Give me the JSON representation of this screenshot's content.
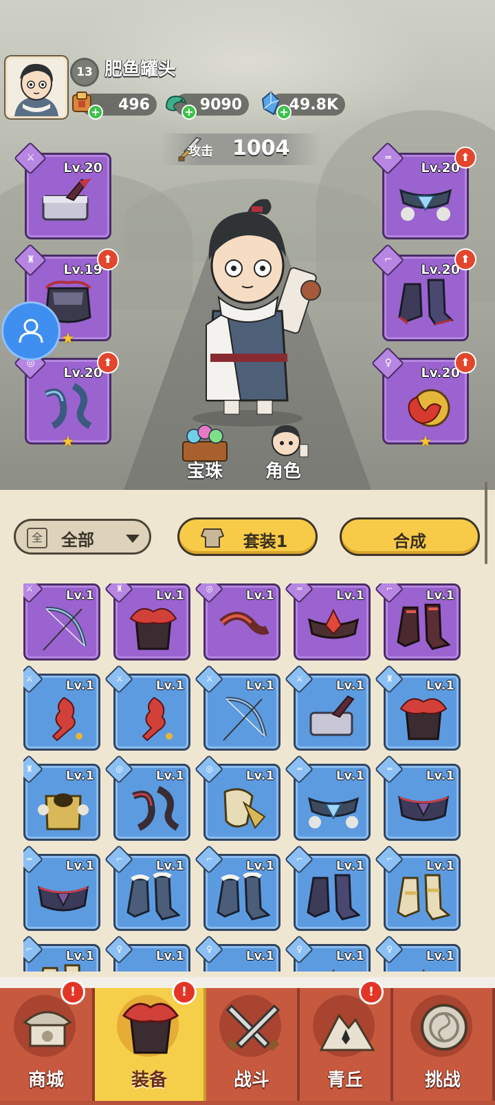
{
  "player": {
    "level": "13",
    "name": "肥鱼罐头"
  },
  "resources": [
    {
      "icon": "scroll-bag-icon",
      "value": "496"
    },
    {
      "icon": "jade-dragon-icon",
      "value": "9090"
    },
    {
      "icon": "blue-crystal-icon",
      "value": "49.8K"
    }
  ],
  "attack": {
    "label": "攻击",
    "value": "1004"
  },
  "equipped": {
    "left": [
      {
        "slot": "weapon",
        "level": "Lv.20",
        "upgrade": false,
        "star": false
      },
      {
        "slot": "helmet",
        "level": "Lv.19",
        "upgrade": true,
        "star": true
      },
      {
        "slot": "bracer",
        "level": "Lv.20",
        "upgrade": true,
        "star": true
      }
    ],
    "right": [
      {
        "slot": "belt",
        "level": "Lv.20",
        "upgrade": true,
        "star": false
      },
      {
        "slot": "boots",
        "level": "Lv.20",
        "upgrade": true,
        "star": false
      },
      {
        "slot": "accessory",
        "level": "Lv.20",
        "upgrade": true,
        "star": true
      }
    ]
  },
  "hero_buttons": {
    "orbs": "宝珠",
    "character": "角色"
  },
  "toolbar": {
    "filter_icon": "全",
    "filter_label": "全部",
    "set_label": "套装1",
    "craft_label": "合成"
  },
  "inventory": [
    {
      "rarity": "purple",
      "slot": "weapon",
      "item": "bow",
      "level": "Lv.1"
    },
    {
      "rarity": "purple",
      "slot": "helmet",
      "item": "red-mask-helmet",
      "level": "Lv.1"
    },
    {
      "rarity": "purple",
      "slot": "bracer",
      "item": "red-bracer",
      "level": "Lv.1"
    },
    {
      "rarity": "purple",
      "slot": "belt",
      "item": "red-belt",
      "level": "Lv.1"
    },
    {
      "rarity": "purple",
      "slot": "boots",
      "item": "red-boots",
      "level": "Lv.1"
    },
    {
      "rarity": "blue",
      "slot": "weapon",
      "item": "flame-blade",
      "level": "Lv.1"
    },
    {
      "rarity": "blue",
      "slot": "weapon",
      "item": "flame-blade",
      "level": "Lv.1"
    },
    {
      "rarity": "blue",
      "slot": "weapon",
      "item": "bow",
      "level": "Lv.1"
    },
    {
      "rarity": "blue",
      "slot": "weapon",
      "item": "hammer",
      "level": "Lv.1"
    },
    {
      "rarity": "blue",
      "slot": "helmet",
      "item": "red-mask-helmet",
      "level": "Lv.1"
    },
    {
      "rarity": "blue",
      "slot": "helmet",
      "item": "gold-helmet",
      "level": "Lv.1"
    },
    {
      "rarity": "blue",
      "slot": "bracer",
      "item": "dark-bracer",
      "level": "Lv.1"
    },
    {
      "rarity": "blue",
      "slot": "bracer",
      "item": "gold-bracer",
      "level": "Lv.1"
    },
    {
      "rarity": "blue",
      "slot": "belt",
      "item": "frost-belt",
      "level": "Lv.1"
    },
    {
      "rarity": "blue",
      "slot": "belt",
      "item": "dark-belt",
      "level": "Lv.1"
    },
    {
      "rarity": "blue",
      "slot": "belt",
      "item": "dark-belt",
      "level": "Lv.1"
    },
    {
      "rarity": "blue",
      "slot": "boots",
      "item": "frost-boots",
      "level": "Lv.1"
    },
    {
      "rarity": "blue",
      "slot": "boots",
      "item": "frost-boots",
      "level": "Lv.1"
    },
    {
      "rarity": "blue",
      "slot": "boots",
      "item": "dark-boots",
      "level": "Lv.1"
    },
    {
      "rarity": "blue",
      "slot": "boots",
      "item": "gold-boots",
      "level": "Lv.1"
    },
    {
      "rarity": "blue",
      "slot": "boots",
      "item": "gold-boots",
      "level": "Lv.1"
    },
    {
      "rarity": "blue",
      "slot": "accessory",
      "item": "blue-charm",
      "level": "Lv.1"
    },
    {
      "rarity": "blue",
      "slot": "accessory",
      "item": "blue-charm",
      "level": "Lv.1"
    },
    {
      "rarity": "blue",
      "slot": "accessory",
      "item": "orb-pendant",
      "level": "Lv.1"
    },
    {
      "rarity": "blue",
      "slot": "accessory",
      "item": "orb-pendant",
      "level": "Lv.1"
    }
  ],
  "nav": [
    {
      "label": "商城",
      "icon": "shop-icon",
      "badge": "!",
      "active": false
    },
    {
      "label": "装备",
      "icon": "equipment-icon",
      "badge": "!",
      "active": true
    },
    {
      "label": "战斗",
      "icon": "battle-icon",
      "badge": "",
      "active": false
    },
    {
      "label": "青丘",
      "icon": "mountain-icon",
      "badge": "!",
      "active": false
    },
    {
      "label": "挑战",
      "icon": "challenge-icon",
      "badge": "",
      "active": false
    }
  ],
  "colors": {
    "purple_card": "#9a63d0",
    "blue_card": "#5d9be0",
    "nav_red": "#c7593e",
    "nav_active": "#f6cf4a",
    "button_yellow": "#f7cb48"
  }
}
